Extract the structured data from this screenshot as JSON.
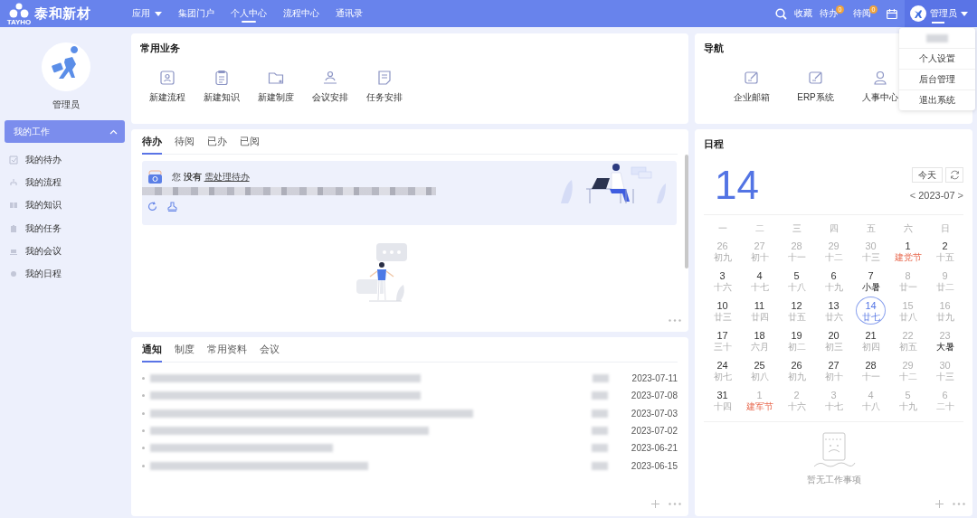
{
  "header": {
    "logo_text": "泰和新材",
    "logo_sub": "TAYHO",
    "menu": [
      {
        "label": "应用",
        "dropdown": true,
        "selected": false
      },
      {
        "label": "集团门户",
        "dropdown": false,
        "selected": false
      },
      {
        "label": "个人中心",
        "dropdown": false,
        "selected": true
      },
      {
        "label": "流程中心",
        "dropdown": false,
        "selected": false
      },
      {
        "label": "通讯录",
        "dropdown": false,
        "selected": false
      }
    ],
    "favorites": "收藏",
    "counters": [
      {
        "label": "待办",
        "count": "0"
      },
      {
        "label": "待阅",
        "count": "0"
      }
    ],
    "user": "管理员"
  },
  "user_menu": [
    "个人设置",
    "后台管理",
    "退出系统"
  ],
  "sidebar": {
    "user": "管理员",
    "group": {
      "label": "我的工作",
      "expanded": true
    },
    "items": [
      {
        "label": "我的待办"
      },
      {
        "label": "我的流程"
      },
      {
        "label": "我的知识"
      },
      {
        "label": "我的任务"
      },
      {
        "label": "我的会议"
      },
      {
        "label": "我的日程"
      }
    ]
  },
  "quick": {
    "title": "常用业务",
    "items": [
      {
        "label": "新建流程"
      },
      {
        "label": "新建知识"
      },
      {
        "label": "新建制度"
      },
      {
        "label": "会议安排"
      },
      {
        "label": "任务安排"
      }
    ]
  },
  "navigation": {
    "title": "导航",
    "items": [
      {
        "label": "企业邮箱"
      },
      {
        "label": "ERP系统"
      },
      {
        "label": "人事中心"
      }
    ]
  },
  "todo": {
    "tabs": [
      {
        "label": "待办",
        "selected": true
      },
      {
        "label": "待阅",
        "selected": false
      },
      {
        "label": "已办",
        "selected": false
      },
      {
        "label": "已阅",
        "selected": false
      }
    ],
    "message": "您 **没有**",
    "link": "需处理待办"
  },
  "notices": {
    "tabs": [
      {
        "label": "通知",
        "selected": true
      },
      {
        "label": "制度",
        "selected": false
      },
      {
        "label": "常用资料",
        "selected": false
      },
      {
        "label": "会议",
        "selected": false
      }
    ],
    "items": [
      {
        "date": "2023-07-11"
      },
      {
        "date": "2023-07-08"
      },
      {
        "date": "2023-07-03"
      },
      {
        "date": "2023-07-02"
      },
      {
        "date": "2023-06-21"
      },
      {
        "date": "2023-06-15"
      }
    ]
  },
  "schedule": {
    "title": "日程",
    "day": "14",
    "today_button": "今天",
    "month": "2023-07",
    "prev": "<",
    "next": ">",
    "weekdays": [
      "一",
      "二",
      "三",
      "四",
      "五",
      "六",
      "日"
    ],
    "days": [
      {
        "n": "26",
        "note": "初九",
        "kind": "lunar",
        "muted": true,
        "selected": false
      },
      {
        "n": "27",
        "note": "初十",
        "kind": "lunar",
        "muted": true,
        "selected": false
      },
      {
        "n": "28",
        "note": "十一",
        "kind": "lunar",
        "muted": true,
        "selected": false
      },
      {
        "n": "29",
        "note": "十二",
        "kind": "lunar",
        "muted": true,
        "selected": false
      },
      {
        "n": "30",
        "note": "十三",
        "kind": "lunar",
        "muted": true,
        "selected": false
      },
      {
        "n": "1",
        "note": "建党节",
        "kind": "holiday",
        "muted": false,
        "selected": false
      },
      {
        "n": "2",
        "note": "十五",
        "kind": "lunar",
        "muted": false,
        "selected": false
      },
      {
        "n": "3",
        "note": "十六",
        "kind": "lunar",
        "muted": false,
        "selected": false
      },
      {
        "n": "4",
        "note": "十七",
        "kind": "lunar",
        "muted": false,
        "selected": false
      },
      {
        "n": "5",
        "note": "十八",
        "kind": "lunar",
        "muted": false,
        "selected": false
      },
      {
        "n": "6",
        "note": "十九",
        "kind": "lunar",
        "muted": false,
        "selected": false
      },
      {
        "n": "7",
        "note": "小暑",
        "kind": "term",
        "muted": false,
        "selected": false
      },
      {
        "n": "8",
        "note": "廿一",
        "kind": "lunar",
        "muted": true,
        "selected": false
      },
      {
        "n": "9",
        "note": "廿二",
        "kind": "lunar",
        "muted": true,
        "selected": false
      },
      {
        "n": "10",
        "note": "廿三",
        "kind": "lunar",
        "muted": false,
        "selected": false
      },
      {
        "n": "11",
        "note": "廿四",
        "kind": "lunar",
        "muted": false,
        "selected": false
      },
      {
        "n": "12",
        "note": "廿五",
        "kind": "lunar",
        "muted": false,
        "selected": false
      },
      {
        "n": "13",
        "note": "廿六",
        "kind": "lunar",
        "muted": false,
        "selected": false
      },
      {
        "n": "14",
        "note": "廿七",
        "kind": "lunar",
        "muted": false,
        "selected": true
      },
      {
        "n": "15",
        "note": "廿八",
        "kind": "lunar",
        "muted": true,
        "selected": false
      },
      {
        "n": "16",
        "note": "廿九",
        "kind": "lunar",
        "muted": true,
        "selected": false
      },
      {
        "n": "17",
        "note": "三十",
        "kind": "lunar",
        "muted": false,
        "selected": false
      },
      {
        "n": "18",
        "note": "六月",
        "kind": "lunar",
        "muted": false,
        "selected": false
      },
      {
        "n": "19",
        "note": "初二",
        "kind": "lunar",
        "muted": false,
        "selected": false
      },
      {
        "n": "20",
        "note": "初三",
        "kind": "lunar",
        "muted": false,
        "selected": false
      },
      {
        "n": "21",
        "note": "初四",
        "kind": "lunar",
        "muted": false,
        "selected": false
      },
      {
        "n": "22",
        "note": "初五",
        "kind": "lunar",
        "muted": true,
        "selected": false
      },
      {
        "n": "23",
        "note": "大暑",
        "kind": "term",
        "muted": true,
        "selected": false
      },
      {
        "n": "24",
        "note": "初七",
        "kind": "lunar",
        "muted": false,
        "selected": false
      },
      {
        "n": "25",
        "note": "初八",
        "kind": "lunar",
        "muted": false,
        "selected": false
      },
      {
        "n": "26",
        "note": "初九",
        "kind": "lunar",
        "muted": false,
        "selected": false
      },
      {
        "n": "27",
        "note": "初十",
        "kind": "lunar",
        "muted": false,
        "selected": false
      },
      {
        "n": "28",
        "note": "十一",
        "kind": "lunar",
        "muted": false,
        "selected": false
      },
      {
        "n": "29",
        "note": "十二",
        "kind": "lunar",
        "muted": true,
        "selected": false
      },
      {
        "n": "30",
        "note": "十三",
        "kind": "lunar",
        "muted": true,
        "selected": false
      },
      {
        "n": "31",
        "note": "十四",
        "kind": "lunar",
        "muted": false,
        "selected": false
      },
      {
        "n": "1",
        "note": "建军节",
        "kind": "holiday",
        "muted": true,
        "selected": false
      },
      {
        "n": "2",
        "note": "十六",
        "kind": "lunar",
        "muted": true,
        "selected": false
      },
      {
        "n": "3",
        "note": "十七",
        "kind": "lunar",
        "muted": true,
        "selected": false
      },
      {
        "n": "4",
        "note": "十八",
        "kind": "lunar",
        "muted": true,
        "selected": false
      },
      {
        "n": "5",
        "note": "十九",
        "kind": "lunar",
        "muted": true,
        "selected": false
      },
      {
        "n": "6",
        "note": "二十",
        "kind": "lunar",
        "muted": true,
        "selected": false
      }
    ],
    "empty_text": "暂无工作事项"
  }
}
